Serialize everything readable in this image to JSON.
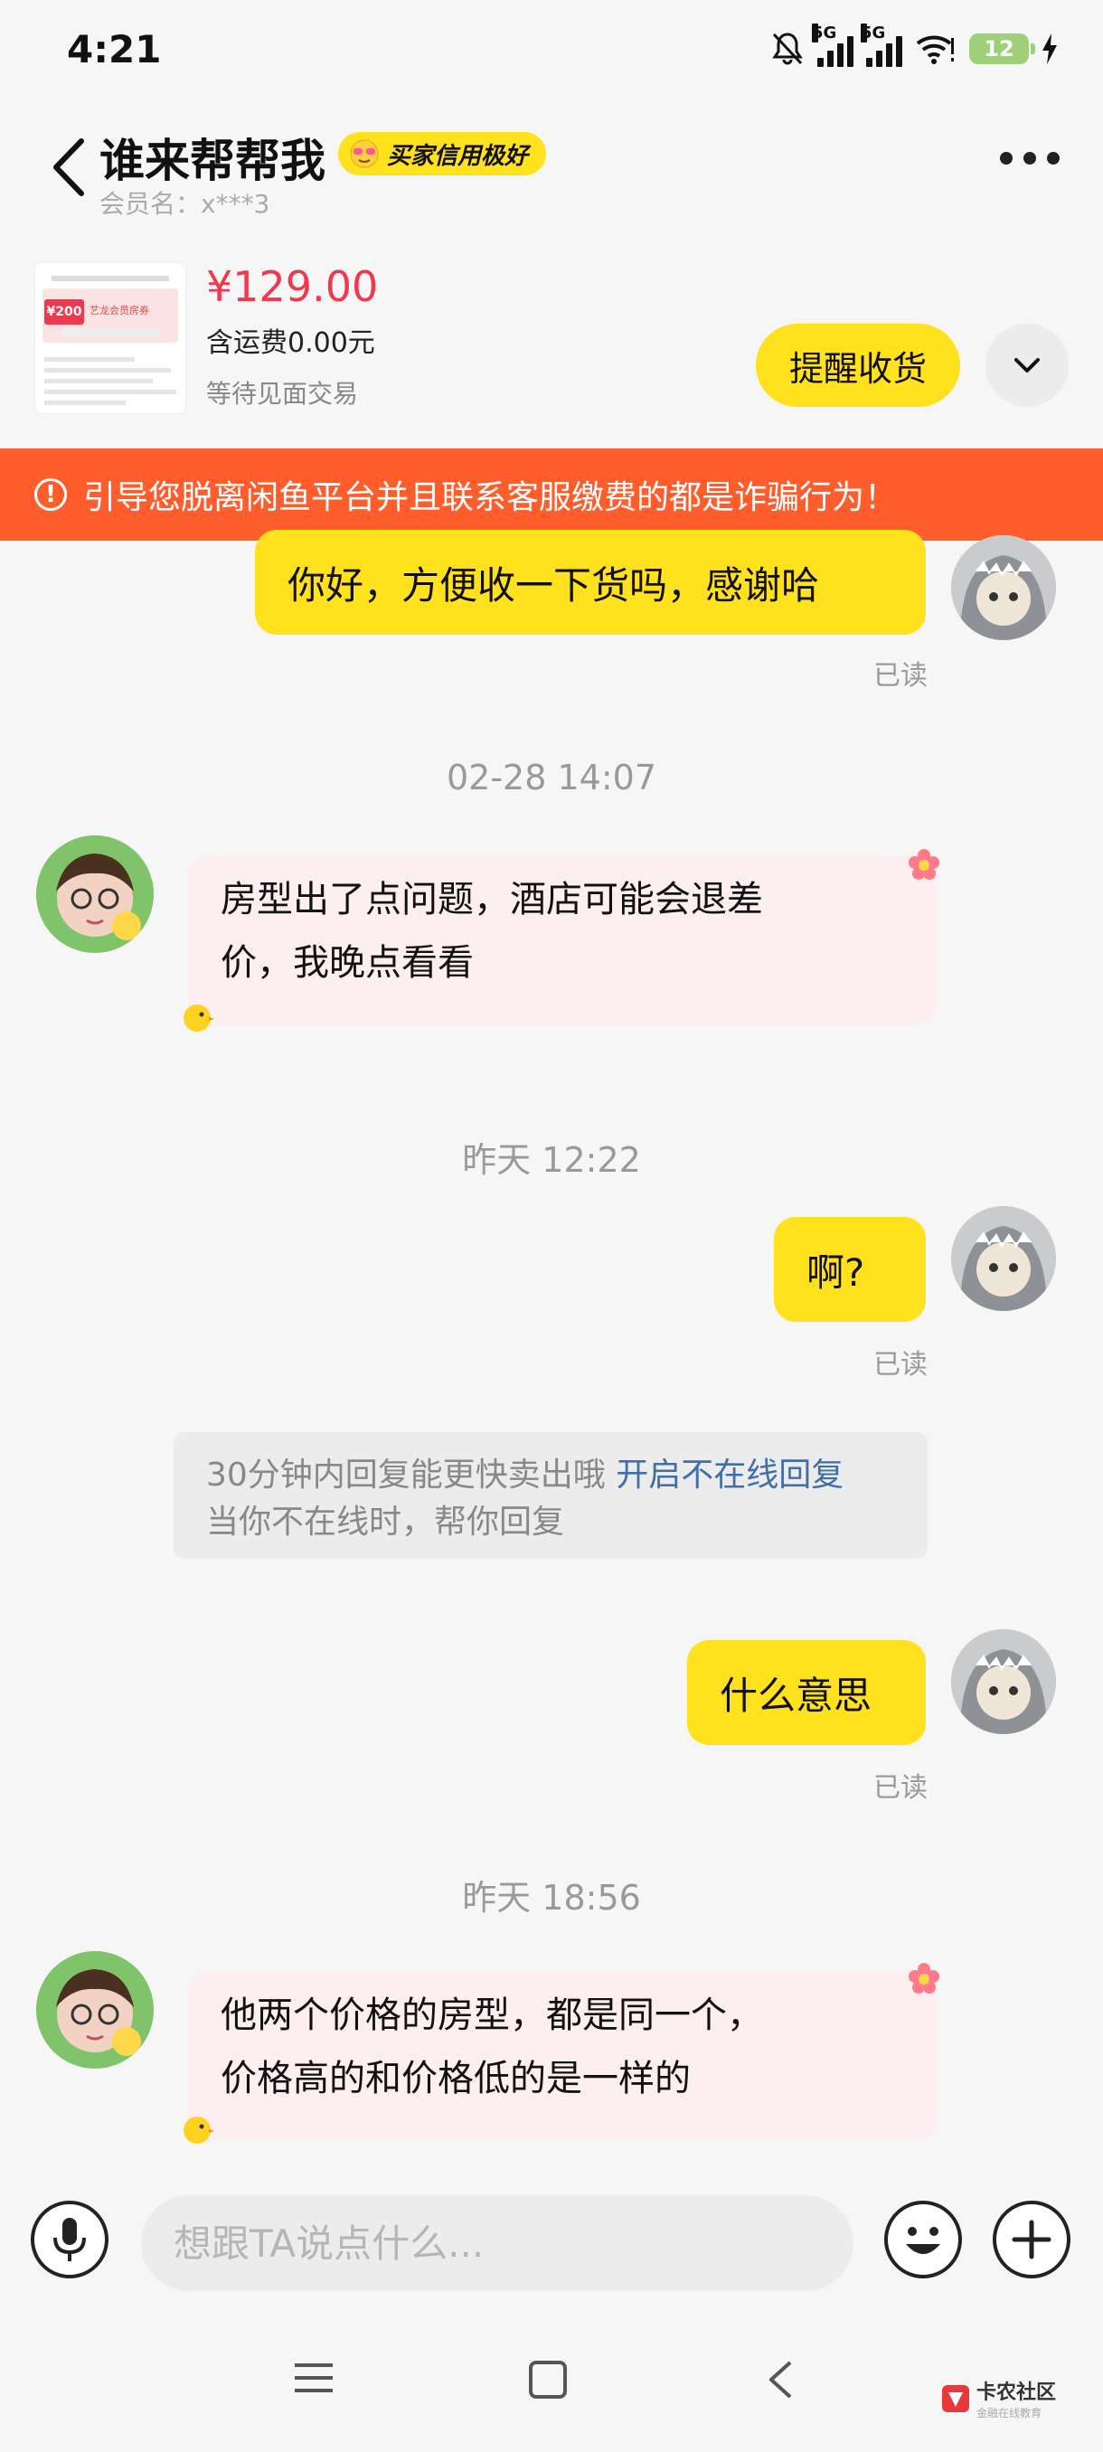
{
  "status_bar": {
    "time": "4:21",
    "network_1": "5G",
    "network_2": "5G",
    "battery": "12"
  },
  "header": {
    "title": "谁来帮帮我",
    "badge": "买家信用极好",
    "member_label": "会员名：x***3"
  },
  "product": {
    "price": "¥129.00",
    "shipping": "含运费0.00元",
    "status": "等待见面交易",
    "remind_button": "提醒收货",
    "thumb_tag": "¥200",
    "thumb_line1": "艺龙会员房券"
  },
  "warning": {
    "text": "引导您脱离闲鱼平台并且联系客服缴费的都是诈骗行为！"
  },
  "messages": {
    "m1": {
      "text": "你好，方便收一下货吗，感谢哈",
      "read": "已读"
    },
    "t1": "02-28 14:07",
    "m2": {
      "line1": "房型出了点问题，酒店可能会退差",
      "line2": "价，我晚点看看"
    },
    "t2": "昨天 12:22",
    "m3": {
      "text": "啊?",
      "read": "已读"
    },
    "tip": {
      "text": "30分钟内回复能更快卖出哦",
      "link": "开启不在线回复",
      "line2": "当你不在线时，帮你回复"
    },
    "m4": {
      "text": "什么意思",
      "read": "已读"
    },
    "t3": "昨天 18:56",
    "m5": {
      "line1": "他两个价格的房型，都是同一个，",
      "line2": "价格高的和价格低的是一样的"
    }
  },
  "input": {
    "placeholder": "想跟TA说点什么..."
  },
  "watermark": {
    "title": "卡农社区",
    "subtitle": "金融在线教育"
  },
  "colors": {
    "accent_yellow": "#ffe11d",
    "warning_orange": "#ff5e2c",
    "price_red": "#f0394e",
    "incoming_bubble": "#fdeef0"
  }
}
